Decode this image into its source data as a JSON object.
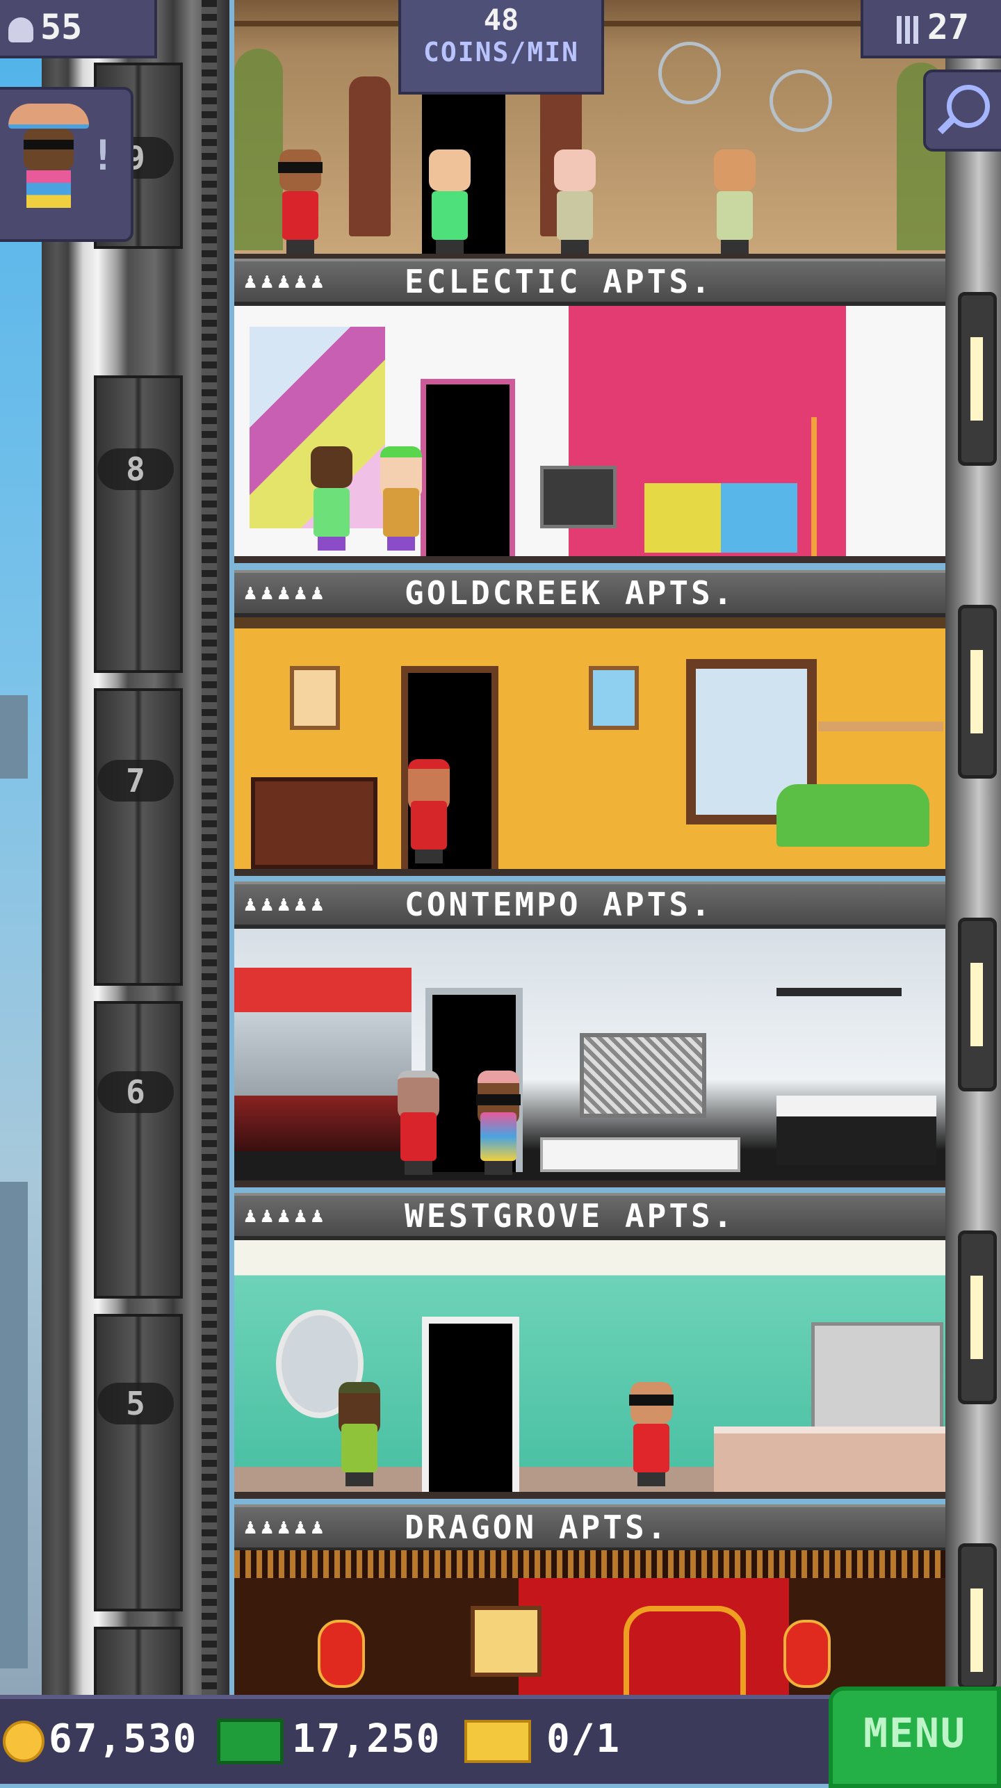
{
  "hud": {
    "population": "55",
    "coins_per_min_value": "48",
    "coins_per_min_label": "COINS/MIN",
    "floor_count": "27"
  },
  "elevator": {
    "floor_numbers": [
      "9",
      "8",
      "7",
      "6",
      "5"
    ]
  },
  "floors": [
    {
      "name": "ECLECTIC APTS.",
      "residents_icons": "♟♟♟♟♟",
      "theme": "eclectic"
    },
    {
      "name": "GOLDCREEK APTS.",
      "residents_icons": "♟♟♟♟♟",
      "theme": "goldcreek"
    },
    {
      "name": "CONTEMPO APTS.",
      "residents_icons": "♟♟♟♟♟",
      "theme": "contempo"
    },
    {
      "name": "WESTGROVE APTS.",
      "residents_icons": "♟♟♟♟♟",
      "theme": "westgrove"
    },
    {
      "name": "DRAGON APTS.",
      "residents_icons": "♟♟♟♟♟",
      "theme": "dragon"
    }
  ],
  "visitor": {
    "alert": "!"
  },
  "bottom_bar": {
    "coins": "67,530",
    "bux": "17,250",
    "tickets": "0/1",
    "menu_label": "MENU"
  },
  "colors": {
    "hud_bg": "#4b4a6e",
    "menu_green": "#24b047",
    "coin_gold": "#f7c23a",
    "bux_green": "#1f9d3a"
  },
  "icons": [
    "population-icon",
    "floor-count-icon",
    "search-icon",
    "coin-icon",
    "bux-icon",
    "ticket-icon"
  ]
}
